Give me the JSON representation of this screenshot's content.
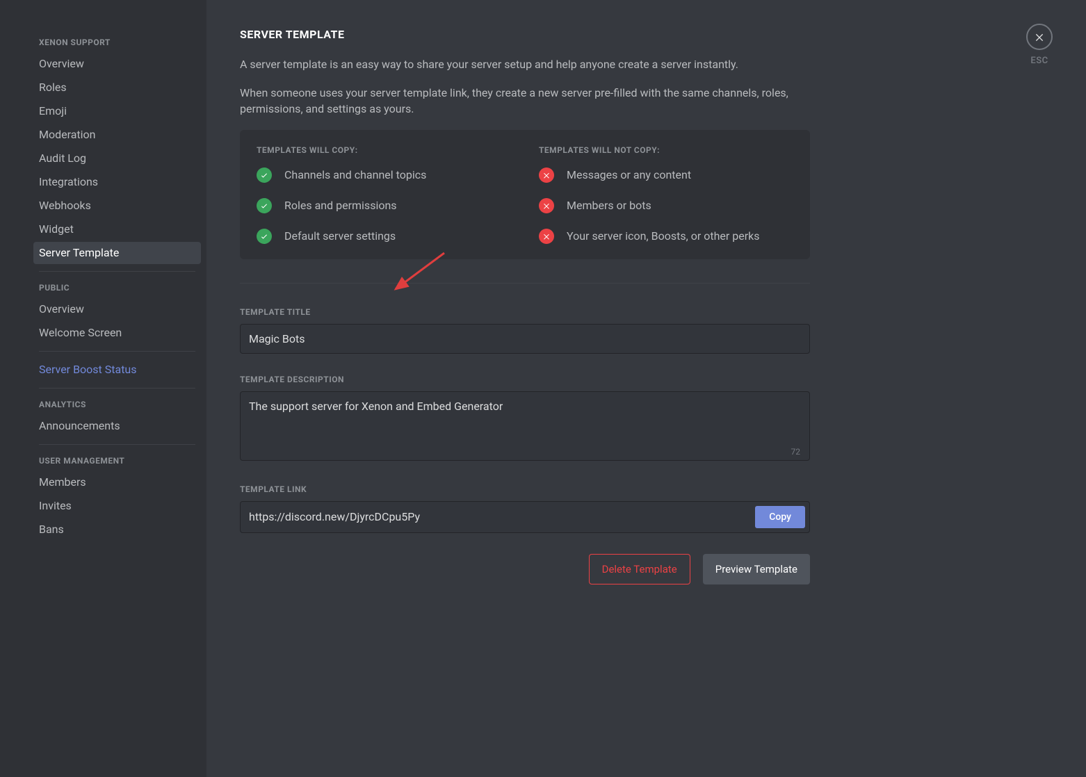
{
  "sidebar": {
    "sections": [
      {
        "heading": "XENON SUPPORT",
        "items": [
          "Overview",
          "Roles",
          "Emoji",
          "Moderation",
          "Audit Log",
          "Integrations",
          "Webhooks",
          "Widget",
          "Server Template"
        ],
        "activeIndex": 8
      },
      {
        "heading": "PUBLIC",
        "items": [
          "Overview",
          "Welcome Screen"
        ]
      },
      {
        "heading": null,
        "items": [
          "Server Boost Status"
        ],
        "nitro": true
      },
      {
        "heading": "ANALYTICS",
        "items": [
          "Announcements"
        ]
      },
      {
        "heading": "USER MANAGEMENT",
        "items": [
          "Members",
          "Invites",
          "Bans"
        ]
      }
    ]
  },
  "close": {
    "esc": "ESC"
  },
  "page": {
    "title": "SERVER TEMPLATE",
    "desc1": "A server template is an easy way to share your server setup and help anyone create a server instantly.",
    "desc2": "When someone uses your server template link, they create a new server pre-filled with the same channels, roles, permissions, and settings as yours.",
    "copyHeading": "TEMPLATES WILL COPY:",
    "noCopyHeading": "TEMPLATES WILL NOT COPY:",
    "willCopy": [
      "Channels and channel topics",
      "Roles and permissions",
      "Default server settings"
    ],
    "wontCopy": [
      "Messages or any content",
      "Members or bots",
      "Your server icon, Boosts, or other perks"
    ],
    "titleLabel": "TEMPLATE TITLE",
    "titleValue": "Magic Bots",
    "descLabel": "TEMPLATE DESCRIPTION",
    "descValue": "The support server for Xenon and Embed Generator",
    "charsLeft": "72",
    "linkLabel": "TEMPLATE LINK",
    "linkValue": "https://discord.new/DjyrcDCpu5Py",
    "copyBtn": "Copy",
    "deleteBtn": "Delete Template",
    "previewBtn": "Preview Template"
  }
}
